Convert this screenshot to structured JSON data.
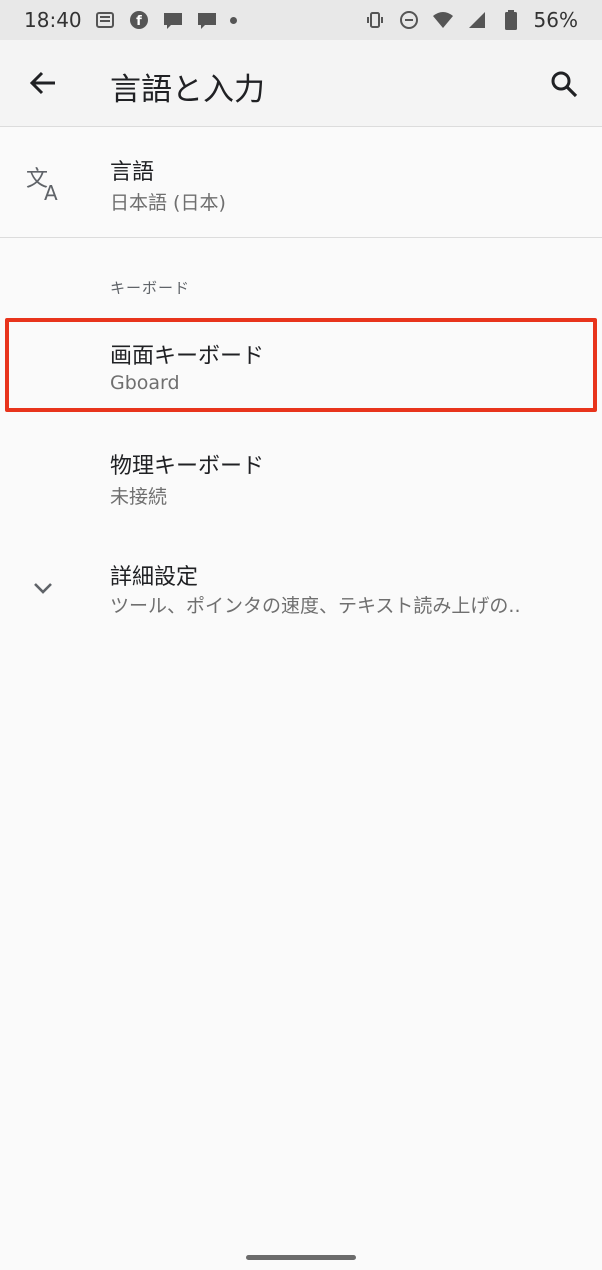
{
  "status_bar": {
    "time": "18:40",
    "battery": "56%",
    "left_icons": [
      "news-icon",
      "facebook-icon",
      "line-manga-icon",
      "line-manga-icon-2",
      "notification-dot"
    ],
    "right_icons": [
      "vibrate-icon",
      "do-not-disturb-icon",
      "wifi-icon",
      "signal-icon",
      "battery-icon"
    ]
  },
  "app_bar": {
    "title": "言語と入力",
    "back_icon": "arrow-back-icon",
    "search_icon": "search-icon"
  },
  "settings": {
    "language": {
      "title": "言語",
      "subtitle": "日本語 (日本)",
      "icon": "translate-icon"
    },
    "section_keyboard": "キーボード",
    "screen_keyboard": {
      "title": "画面キーボード",
      "subtitle": "Gboard"
    },
    "physical_keyboard": {
      "title": "物理キーボード",
      "subtitle": "未接続"
    },
    "advanced": {
      "title": "詳細設定",
      "subtitle": "ツール、ポインタの速度、テキスト読み上げの..",
      "icon": "chevron-down-icon"
    }
  },
  "colors": {
    "highlight": "#e8341c",
    "background": "#fafafa",
    "status_bar": "#e8e8e8"
  }
}
